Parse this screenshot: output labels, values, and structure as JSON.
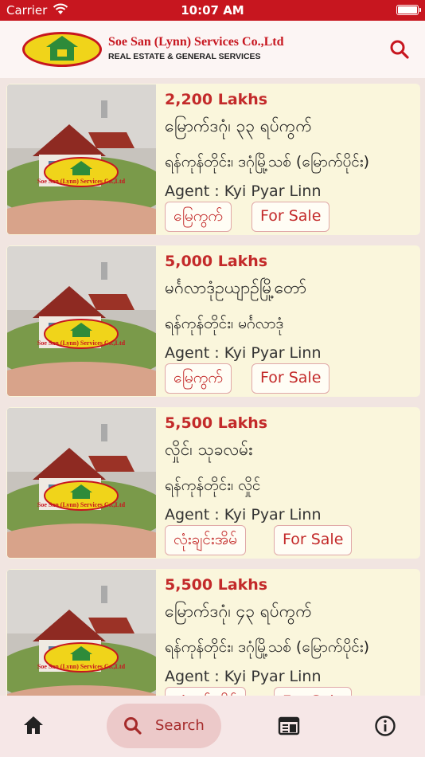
{
  "status_bar": {
    "carrier": "Carrier",
    "time": "10:07 AM"
  },
  "header": {
    "company_name": "Soe San (Lynn) Services Co.,Ltd",
    "company_sub": "REAL ESTATE & GENERAL SERVICES",
    "search_icon": "search-icon"
  },
  "listings": [
    {
      "price": "2,200 Lakhs",
      "title": "မြောက်ဒဂုံ၊ ၃၃ ရပ်ကွက်",
      "address": "ရန်ကုန်တိုင်း၊ ဒဂုံမြို့သစ် (မြောက်ပိုင်း)",
      "agent": "Agent : Kyi Pyar Linn",
      "category": "မြေကွက်",
      "status": "For Sale"
    },
    {
      "price": "5,000 Lakhs",
      "title": "မင်္ဂလာဒုံဥယျာဉ်မြို့တော်",
      "address": "ရန်ကုန်တိုင်း၊ မင်္ဂလာဒုံ",
      "agent": "Agent : Kyi Pyar Linn",
      "category": "မြေကွက်",
      "status": "For Sale"
    },
    {
      "price": "5,500 Lakhs",
      "title": "လှိုင်၊ သုခလမ်း",
      "address": "ရန်ကုန်တိုင်း၊ လှိုင်",
      "agent": "Agent : Kyi Pyar Linn",
      "category": "လုံးချင်းအိမ်",
      "status": "For Sale"
    },
    {
      "price": "5,500 Lakhs",
      "title": "မြောက်ဒဂုံ၊ ၄၃ ရပ်ကွက်",
      "address": "ရန်ကုန်တိုင်း၊ ဒဂုံမြို့သစ် (မြောက်ပိုင်း)",
      "agent": "Agent : Kyi Pyar Linn",
      "category": "လုံးချင်းအိမ်",
      "status": "For Sale"
    }
  ],
  "thumbnail_logo_text": "Soe San (Lynn) Services Co.,Ltd",
  "tabbar": {
    "home_icon": "home-icon",
    "search_label": "Search",
    "news_icon": "newspaper-icon",
    "info_icon": "info-icon"
  },
  "colors": {
    "brand_red": "#c7161f",
    "card_bg": "#faf6dc",
    "price_red": "#c32a2a",
    "logo_yellow": "#f0d41a",
    "logo_green": "#2e8b3a"
  }
}
